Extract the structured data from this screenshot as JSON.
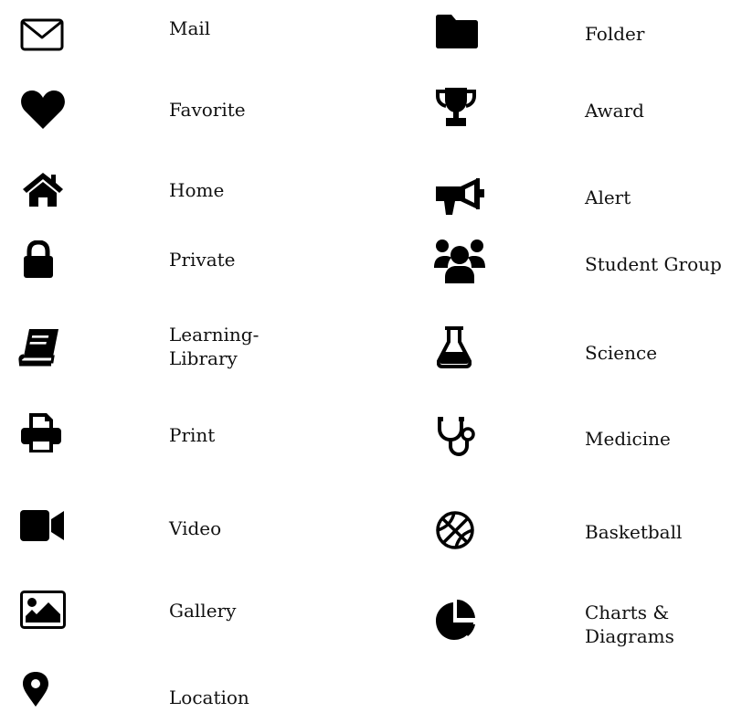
{
  "left_column": [
    {
      "icon": "mail-icon",
      "label": "Mail"
    },
    {
      "icon": "heart-icon",
      "label": "Favorite"
    },
    {
      "icon": "home-icon",
      "label": "Home"
    },
    {
      "icon": "lock-icon",
      "label": "Private"
    },
    {
      "icon": "book-icon",
      "label": "Learning-\nLibrary"
    },
    {
      "icon": "printer-icon",
      "label": "Print"
    },
    {
      "icon": "video-camera-icon",
      "label": "Video"
    },
    {
      "icon": "image-icon",
      "label": "Gallery"
    },
    {
      "icon": "map-marker-icon",
      "label": "Location"
    }
  ],
  "right_column": [
    {
      "icon": "folder-icon",
      "label": "Folder"
    },
    {
      "icon": "trophy-icon",
      "label": "Award"
    },
    {
      "icon": "megaphone-icon",
      "label": "Alert"
    },
    {
      "icon": "users-icon",
      "label": "Student Group"
    },
    {
      "icon": "flask-icon",
      "label": "Science"
    },
    {
      "icon": "stethoscope-icon",
      "label": "Medicine"
    },
    {
      "icon": "basketball-icon",
      "label": "Basketball"
    },
    {
      "icon": "pie-chart-icon",
      "label": "Charts &\nDiagrams"
    }
  ],
  "colors": {
    "icon": "#000000",
    "text": "#111111",
    "background": "#ffffff"
  }
}
